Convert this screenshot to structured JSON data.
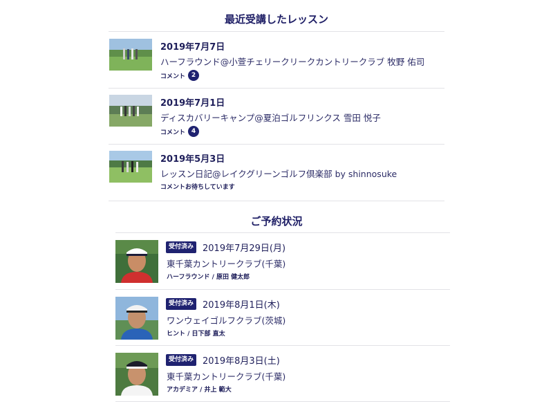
{
  "recent_lessons": {
    "title": "最近受講したレッスン",
    "items": [
      {
        "date": "2019年7月7日",
        "title": "ハーフラウンド@小萱チェリークリークカントリークラブ 牧野 佑司",
        "comment_label": "コメント",
        "comment_count": "2"
      },
      {
        "date": "2019年7月1日",
        "title": "ディスカバリーキャンプ@夏泊ゴルフリンクス 雪田 悦子",
        "comment_label": "コメント",
        "comment_count": "4"
      },
      {
        "date": "2019年5月3日",
        "title": "レッスン日記@レイクグリーンゴルフ倶楽部 by shinnosuke",
        "comment_label": "コメントお待ちしています",
        "comment_count": ""
      }
    ]
  },
  "reservations": {
    "title": "ご予約状況",
    "items": [
      {
        "status": "受付済み",
        "date": "2019年7月29日(月)",
        "club": "東千葉カントリークラブ(千葉)",
        "detail": "ハーフラウンド / 原田 健太郎"
      },
      {
        "status": "受付済み",
        "date": "2019年8月1日(木)",
        "club": "ワンウェイゴルフクラブ(茨城)",
        "detail": "ヒント / 日下部 直太"
      },
      {
        "status": "受付済み",
        "date": "2019年8月3日(土)",
        "club": "東千葉カントリークラブ(千葉)",
        "detail": "アカデミア / 井上 範大"
      }
    ]
  },
  "colors": {
    "navy": "#1f2270",
    "text": "#1e1e5a",
    "divider": "#e2e2e6"
  }
}
